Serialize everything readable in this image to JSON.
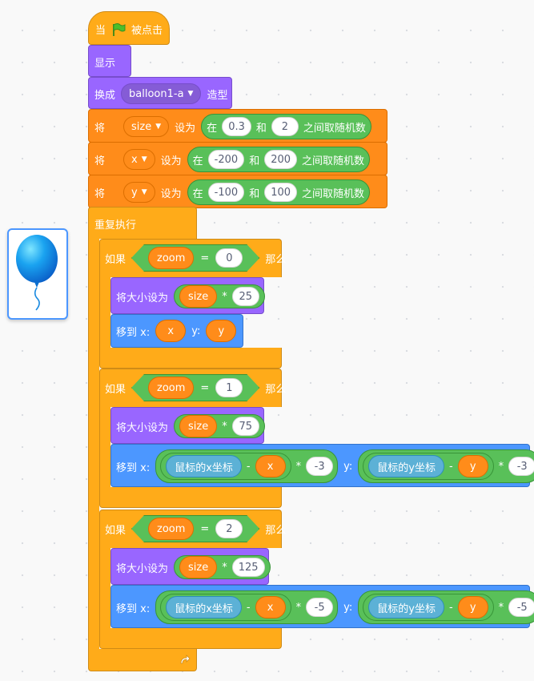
{
  "hat": {
    "when": "当",
    "clicked": "被点击",
    "flag_icon": "green-flag-icon"
  },
  "show_label": "显示",
  "switch_costume": {
    "label": "换成",
    "value": "balloon1-a",
    "suffix": "造型"
  },
  "set_vars": [
    {
      "set": "将",
      "var": "size",
      "to": "设为",
      "in": "在",
      "min": "0.3",
      "and": "和",
      "max": "2",
      "pick": "之间取随机数"
    },
    {
      "set": "将",
      "var": "x",
      "to": "设为",
      "in": "在",
      "min": "-200",
      "and": "和",
      "max": "200",
      "pick": "之间取随机数"
    },
    {
      "set": "将",
      "var": "y",
      "to": "设为",
      "in": "在",
      "min": "-100",
      "and": "和",
      "max": "100",
      "pick": "之间取随机数"
    }
  ],
  "forever_label": "重复执行",
  "ifs": [
    {
      "if": "如果",
      "var": "zoom",
      "eq": "=",
      "value": "0",
      "then": "那么",
      "size_label": "将大小设为",
      "size_var": "size",
      "mul": "*",
      "factor": "25",
      "goto": "移到 x:",
      "x": "x",
      "y_label": "y:",
      "y": "y"
    },
    {
      "if": "如果",
      "var": "zoom",
      "eq": "=",
      "value": "1",
      "then": "那么",
      "size_label": "将大小设为",
      "size_var": "size",
      "mul": "*",
      "factor": "75",
      "goto": "移到 x:",
      "mouse_x": "鼠标的x坐标",
      "minus": "-",
      "x": "x",
      "mul2": "*",
      "kx": "-3",
      "y_label": "y:",
      "mouse_y": "鼠标的y坐标",
      "y": "y",
      "ky": "-3"
    },
    {
      "if": "如果",
      "var": "zoom",
      "eq": "=",
      "value": "2",
      "then": "那么",
      "size_label": "将大小设为",
      "size_var": "size",
      "mul": "*",
      "factor": "125",
      "goto": "移到 x:",
      "mouse_x": "鼠标的x坐标",
      "minus": "-",
      "x": "x",
      "mul2": "*",
      "kx": "-5",
      "y_label": "y:",
      "mouse_y": "鼠标的y坐标",
      "y": "y",
      "ky": "-5"
    }
  ],
  "loop_arrow_icon": "loop-arrow-icon",
  "sprite_icon": "balloon-sprite-thumbnail"
}
